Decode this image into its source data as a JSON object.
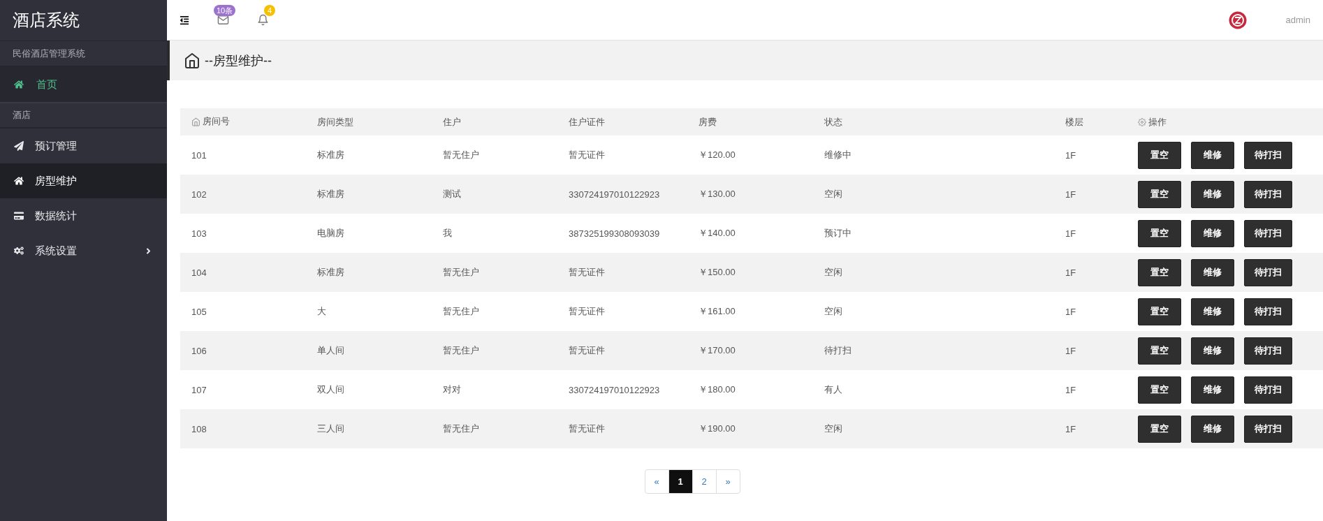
{
  "sidebar": {
    "title": "酒店系统",
    "subtitle": "民俗酒店管理系统",
    "home": {
      "label": "首页"
    },
    "section_label": "酒店",
    "items": [
      {
        "label": "预订管理",
        "kind": "plane",
        "selected": false
      },
      {
        "label": "房型维护",
        "kind": "home",
        "selected": true
      },
      {
        "label": "数据统计",
        "kind": "card",
        "selected": false
      },
      {
        "label": "系统设置",
        "kind": "gears",
        "selected": false,
        "expanded": false
      }
    ]
  },
  "topbar": {
    "mail_badge": "10条",
    "bell_badge": "4",
    "user": "admin"
  },
  "breadcrumb": "--房型维护--",
  "table": {
    "columns": [
      "房间号",
      "房间类型",
      "住户",
      "住户证件",
      "房费",
      "状态",
      "楼层",
      "操作"
    ],
    "rows": [
      {
        "cells": [
          "101",
          "标准房",
          "暂无住户",
          "暂无证件",
          "￥120.00",
          "维修中",
          "1F"
        ],
        "actions": [
          "置空",
          "维修",
          "待打扫"
        ]
      },
      {
        "cells": [
          "102",
          "标准房",
          "测试",
          "330724197010122923",
          "￥130.00",
          "空闲",
          "1F"
        ],
        "actions": [
          "置空",
          "维修",
          "待打扫"
        ]
      },
      {
        "cells": [
          "103",
          "电脑房",
          "我",
          "387325199308093039",
          "￥140.00",
          "预订中",
          "1F"
        ],
        "actions": [
          "置空",
          "维修",
          "待打扫"
        ]
      },
      {
        "cells": [
          "104",
          "标准房",
          "暂无住户",
          "暂无证件",
          "￥150.00",
          "空闲",
          "1F"
        ],
        "actions": [
          "置空",
          "维修",
          "待打扫"
        ]
      },
      {
        "cells": [
          "105",
          "大",
          "暂无住户",
          "暂无证件",
          "￥161.00",
          "空闲",
          "1F"
        ],
        "actions": [
          "置空",
          "维修",
          "待打扫"
        ]
      },
      {
        "cells": [
          "106",
          "单人间",
          "暂无住户",
          "暂无证件",
          "￥170.00",
          "待打扫",
          "1F"
        ],
        "actions": [
          "置空",
          "维修",
          "待打扫"
        ]
      },
      {
        "cells": [
          "107",
          "双人间",
          "对对",
          "330724197010122923",
          "￥180.00",
          "有人",
          "1F"
        ],
        "actions": [
          "置空",
          "维修",
          "待打扫"
        ]
      },
      {
        "cells": [
          "108",
          "三人间",
          "暂无住户",
          "暂无证件",
          "￥190.00",
          "空闲",
          "1F"
        ],
        "actions": [
          "置空",
          "维修",
          "待打扫"
        ]
      }
    ]
  },
  "pagination": {
    "prev": "«",
    "next": "»",
    "pages": [
      {
        "label": "1",
        "selected": true
      },
      {
        "label": "2",
        "selected": false
      }
    ]
  }
}
